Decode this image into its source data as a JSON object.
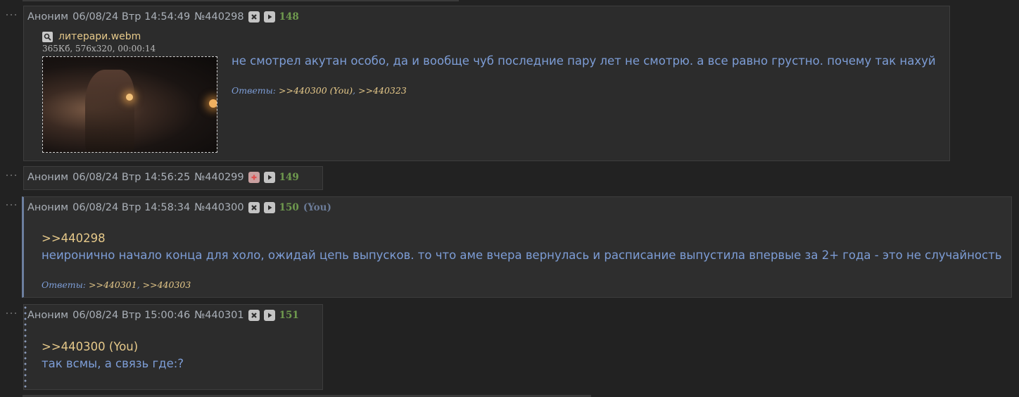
{
  "posts": [
    {
      "author": "Аноним",
      "date": "06/08/24 Втр 14:54:49",
      "number": "№440298",
      "seq": "148",
      "file": {
        "name": "литерари.webm",
        "meta": "365Кб, 576x320, 00:00:14"
      },
      "text": "не смотрел акутан особо, да и вообще чуб последние пару лет не смотрю. а все равно грустно. почему так нахуй",
      "replies_label": "Ответы:",
      "replies": [
        ">>440300 (You)",
        ">>440323"
      ]
    },
    {
      "author": "Аноним",
      "date": "06/08/24 Втр 14:56:25",
      "number": "№440299",
      "seq": "149"
    },
    {
      "author": "Аноним",
      "date": "06/08/24 Втр 14:58:34",
      "number": "№440300",
      "seq": "150",
      "you": "(You)",
      "quote": ">>440298",
      "text": "неиронично начало конца для холо, ожидай цепь выпусков. то что аме вчера вернулась и расписание выпустила впервые за 2+ года - это не случайность",
      "replies_label": "Ответы:",
      "replies": [
        ">>440301",
        ">>440303"
      ]
    },
    {
      "author": "Аноним",
      "date": "06/08/24 Втр 15:00:46",
      "number": "№440301",
      "seq": "151",
      "quote": ">>440300 (You)",
      "text": "так всмы, а связь где:?"
    }
  ],
  "icons": {
    "hide": "close-icon",
    "show": "plus-icon",
    "play": "play-icon",
    "search": "magnifier-icon"
  },
  "colors": {
    "background": "#222222",
    "post_bg": "#2c2c2c",
    "text_blue": "#7d9dd6",
    "quote_gold": "#e6c98a",
    "seq_green": "#6f9a4e",
    "you_grey_blue": "#6b7b97"
  }
}
